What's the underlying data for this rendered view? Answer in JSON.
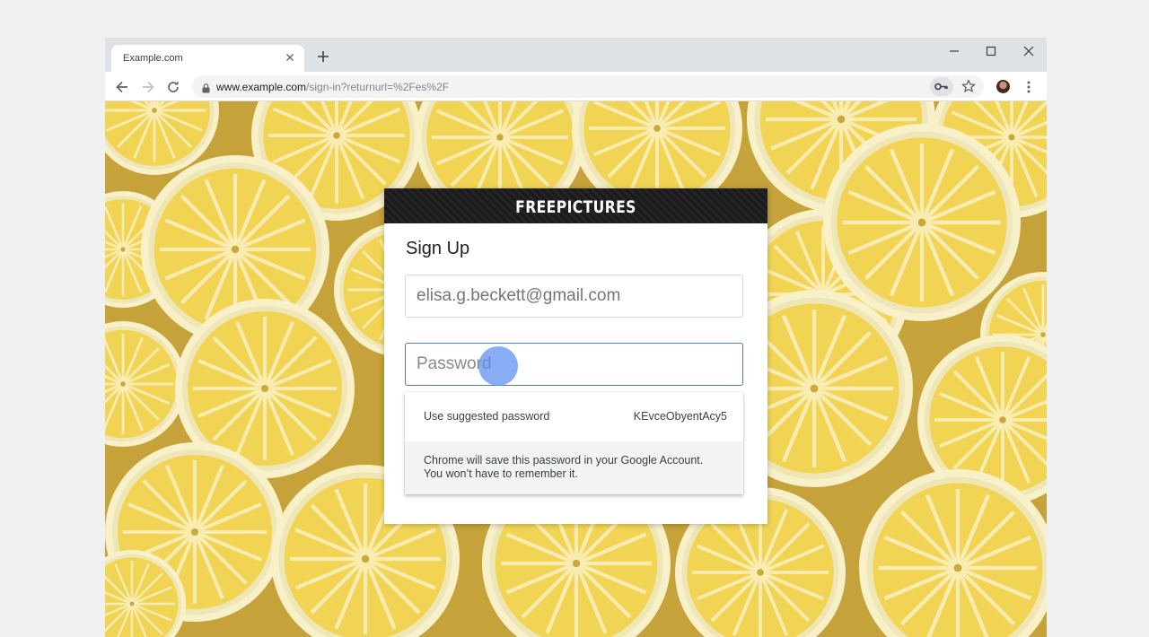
{
  "tab": {
    "title": "Example.com"
  },
  "toolbar": {
    "url_host": "www.example.com",
    "url_path": "/sign-in?returnurl=%2Fes%2F"
  },
  "icons": {
    "back": "back-arrow-icon",
    "forward": "forward-arrow-icon",
    "reload": "reload-icon",
    "lock": "lock-icon",
    "key": "key-icon",
    "star": "star-icon",
    "menu": "more-vert-icon"
  },
  "card": {
    "brand": "FREEPICTURES",
    "heading": "Sign Up",
    "email_value": "elisa.g.beckett@gmail.com",
    "password_placeholder": "Password"
  },
  "suggestion": {
    "label": "Use suggested password",
    "password": "KEvceObyentAcy5",
    "note_line1": "Chrome will save this password in your Google Account.",
    "note_line2": "You won’t have to remember it."
  },
  "colors": {
    "focus_border": "#4a7bd0",
    "cursor": "#5a8ef0",
    "lemon": "#f3d95c"
  }
}
